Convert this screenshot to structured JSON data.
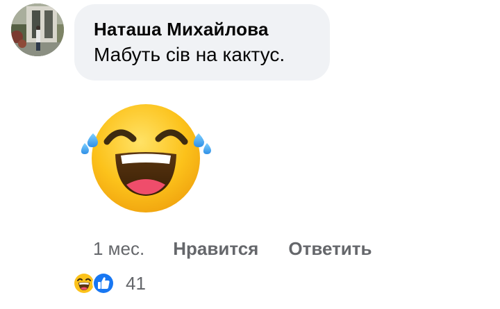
{
  "comment": {
    "author": "Наташа Михайлова",
    "text": "Мабуть сів на кактус."
  },
  "sticker": {
    "icon": "laughing-tears-emoji-icon"
  },
  "actions": {
    "timestamp": "1 мес.",
    "like_label": "Нравится",
    "reply_label": "Ответить"
  },
  "reactions": {
    "icons": [
      "haha-reaction-icon",
      "like-reaction-icon"
    ],
    "count": "41"
  },
  "colors": {
    "bubble_bg": "#f0f2f5",
    "secondary_text": "#65676b",
    "like_blue": "#1877f2",
    "emoji_yellow": "#fcc21b"
  }
}
